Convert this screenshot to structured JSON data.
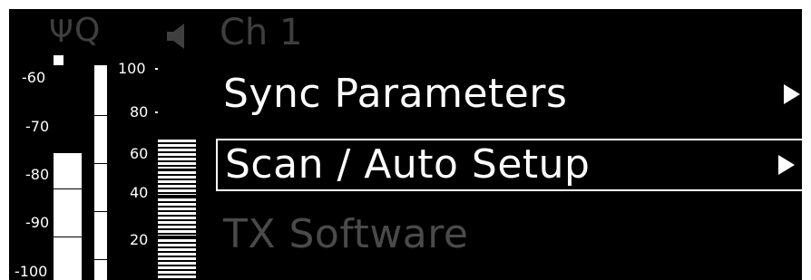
{
  "status_bar": {
    "antenna_icon": "antenna-icon",
    "q_text": "Q",
    "speaker_icon": "speaker-icon",
    "channel": "Ch 1"
  },
  "rf_meter": {
    "labels": [
      "-60",
      "-70",
      "-80",
      "-90",
      "-100"
    ]
  },
  "af_meter": {
    "labels": [
      "100",
      "80",
      "60",
      "40",
      "20"
    ]
  },
  "menu": {
    "items": [
      {
        "label": "Sync Parameters",
        "selected": false,
        "enabled": true,
        "has_submenu": true
      },
      {
        "label": "Scan / Auto Setup",
        "selected": true,
        "enabled": true,
        "has_submenu": true
      },
      {
        "label": "TX Software",
        "selected": false,
        "enabled": false,
        "has_submenu": false
      }
    ]
  },
  "colors": {
    "background": "#000000",
    "foreground": "#ffffff",
    "dimmed": "#3f3f3f"
  }
}
